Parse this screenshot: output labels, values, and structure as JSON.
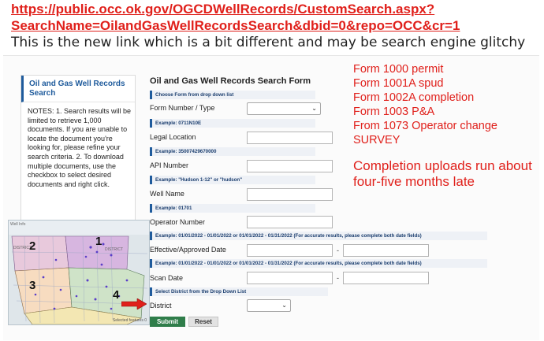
{
  "header": {
    "url": "https://public.occ.ok.gov/OGCDWellRecords/CustomSearch.aspx?SearchName=OilandGasWellRecordsSearch&dbid=0&repo=OCC&cr=1",
    "note": "This is the new link which is a bit different and may be search engine glitchy"
  },
  "sidebar": {
    "title": "Oil and Gas Well Records Search",
    "notes": "NOTES: 1. Search results will be limited to retrieve 1,000 documents. If you are unable to locate the document you're looking for, please refine your search criteria. 2. To download multiple documents, use the checkbox to select desired documents and right click."
  },
  "map": {
    "header": "Well Info",
    "district_label": "DISTRICT",
    "districts": [
      "1",
      "2",
      "3",
      "4"
    ],
    "footer": "Selected features 0"
  },
  "form": {
    "title": "Oil and Gas Well Records Search Form",
    "hint_form": "Choose Form from drop down list",
    "form_number_label": "Form Number / Type",
    "hint_legal": "Example: 0711N10E",
    "legal_location_label": "Legal Location",
    "hint_api": "Example: 35007429670000",
    "api_number_label": "API Number",
    "hint_well": "Example: \"Hudson 1-12\" or \"hudson\"",
    "well_name_label": "Well Name",
    "hint_operator": "Example: 01701",
    "operator_number_label": "Operator Number",
    "hint_effective": "Example: 01/01/2022 - 01/01/2022 or 01/01/2022 - 01/31/2022 (For accurate results, please complete both date fields)",
    "effective_date_label": "Effective/Approved Date",
    "hint_scan": "Example: 01/01/2022 - 01/01/2022 or 01/01/2022 - 01/31/2022 (For accurate results, please complete both date fields)",
    "scan_date_label": "Scan Date",
    "hint_district": "Select District from the Drop Down List",
    "district_label": "District",
    "range_dash": "-",
    "submit_label": "Submit",
    "reset_label": "Reset"
  },
  "annotations": {
    "forms": [
      "Form 1000 permit",
      "Form 1001A spud",
      "Form 1002A completion",
      "Form 1003 P&A",
      "From 1073 Operator change",
      "SURVEY"
    ],
    "completion_note": "Completion uploads run about four-five months late"
  },
  "colors": {
    "annotation_red": "#e0201b",
    "link_blue": "#1f5b9c",
    "submit_green": "#2f7d4a"
  }
}
